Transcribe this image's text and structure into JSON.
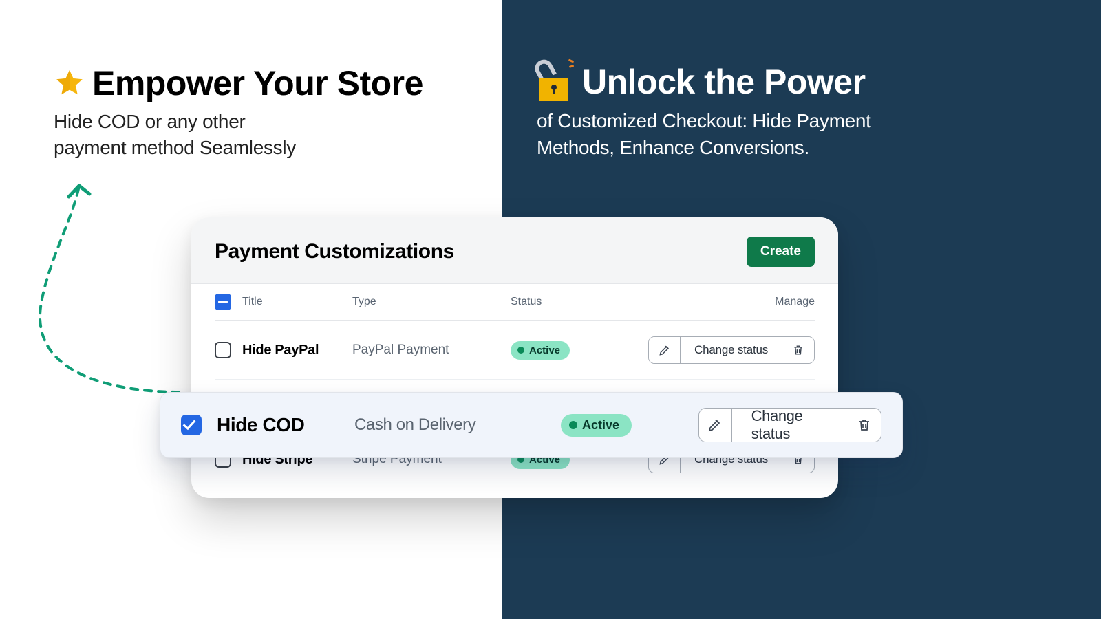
{
  "left": {
    "title": "Empower Your Store",
    "subtitle_line1": "Hide COD or any other",
    "subtitle_line2": "payment method Seamlessly"
  },
  "right": {
    "title": "Unlock the Power",
    "subtitle_line1": "of Customized Checkout: Hide Payment",
    "subtitle_line2": "Methods, Enhance Conversions."
  },
  "card": {
    "title": "Payment Customizations",
    "create_label": "Create",
    "columns": {
      "title": "Title",
      "type": "Type",
      "status": "Status",
      "manage": "Manage"
    },
    "change_status_label": "Change status",
    "rows": [
      {
        "title": "Hide PayPal",
        "type": "PayPal Payment",
        "status": "Active",
        "checked": false
      },
      {
        "title": "Hide COD",
        "type": "Cash on Delivery",
        "status": "Active",
        "checked": true
      },
      {
        "title": "Hide Stripe",
        "type": "Stripe Payment",
        "status": "Active",
        "checked": false
      }
    ]
  },
  "colors": {
    "brand_green": "#0f7a4a",
    "accent_blue": "#2467e3",
    "dark_panel": "#1c3b54",
    "badge_bg": "#8be4c4",
    "teal_arrow": "#0f9d76"
  }
}
